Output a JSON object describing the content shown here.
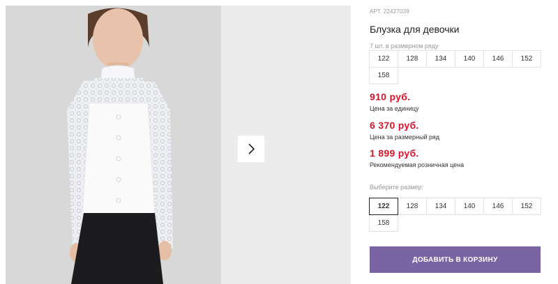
{
  "product": {
    "sku": "АРТ. 22427039",
    "title": "Блузка для девочки",
    "image_alt": "girl-in-white-lace-blouse"
  },
  "gallery": {
    "next_icon": "chevron-right-icon"
  },
  "pack": {
    "note": "7 шт. в размерном ряду",
    "sizes": [
      "122",
      "128",
      "134",
      "140",
      "146",
      "152",
      "158"
    ]
  },
  "prices": {
    "unit": {
      "value": "910 руб.",
      "label": "Цена за единицу"
    },
    "pack": {
      "value": "6 370 руб.",
      "label": "Цена за размерный ряд"
    },
    "retail": {
      "value": "1 899 руб.",
      "label": "Рекомендуемая розничная цена"
    }
  },
  "size_select": {
    "label": "Выберите размер:",
    "sizes": [
      "122",
      "128",
      "134",
      "140",
      "146",
      "152",
      "158"
    ],
    "selected": "122"
  },
  "cart": {
    "button_label": "ДОБАВИТЬ В КОРЗИНУ"
  },
  "colors": {
    "price": "#d9142b",
    "button": "#7b64a4"
  }
}
